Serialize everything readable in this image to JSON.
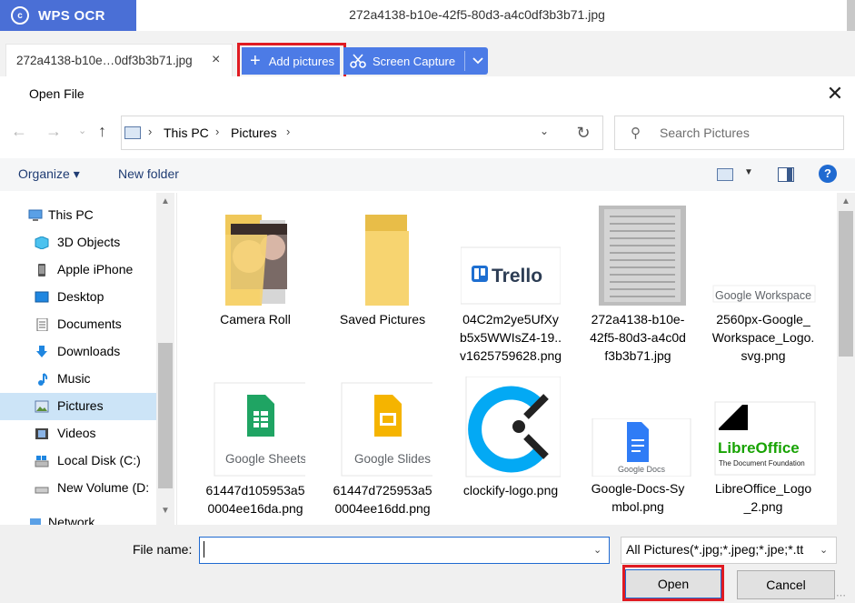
{
  "app": {
    "brand": "WPS OCR",
    "filename": "272a4138-b10e-42f5-80d3-a4c0df3b3b71.jpg",
    "tab_label": "272a4138-b10e…0df3b3b71.jpg",
    "tab_close": "×",
    "add_pictures": "Add pictures",
    "screen_capture": "Screen Capture"
  },
  "dialog": {
    "title": "Open File",
    "close": "✕",
    "address": {
      "items": [
        "This PC",
        "Pictures"
      ]
    },
    "search_placeholder": "Search Pictures",
    "toolbar": {
      "organize": "Organize ▾",
      "new_folder": "New folder"
    },
    "nav_items": [
      {
        "label": "This PC",
        "icon": "computer-icon"
      },
      {
        "label": "3D Objects",
        "icon": "cube-icon"
      },
      {
        "label": "Apple iPhone",
        "icon": "phone-icon"
      },
      {
        "label": "Desktop",
        "icon": "desktop-icon"
      },
      {
        "label": "Documents",
        "icon": "document-icon"
      },
      {
        "label": "Downloads",
        "icon": "download-icon"
      },
      {
        "label": "Music",
        "icon": "music-icon"
      },
      {
        "label": "Pictures",
        "icon": "pictures-icon"
      },
      {
        "label": "Videos",
        "icon": "video-icon"
      },
      {
        "label": "Local Disk (C:)",
        "icon": "disk-icon"
      },
      {
        "label": "New Volume (D:",
        "icon": "drive-icon"
      },
      {
        "label": "Network",
        "icon": "network-icon"
      }
    ],
    "files": [
      {
        "name": [
          "Camera Roll"
        ]
      },
      {
        "name": [
          "Saved Pictures"
        ]
      },
      {
        "name": [
          "04C2m2ye5UfXy",
          "b5x5WWIsZ4-19..",
          "v1625759628.png"
        ],
        "logo": "Trello"
      },
      {
        "name": [
          "272a4138-b10e-",
          "42f5-80d3-a4c0d",
          "f3b3b71.jpg"
        ]
      },
      {
        "name": [
          "2560px-Google_",
          "Workspace_Logo.",
          "svg.png"
        ],
        "logo": "Google Workspace"
      },
      {
        "name": [
          "61447d105953a5",
          "0004ee16da.png"
        ],
        "logo": "Google Sheets"
      },
      {
        "name": [
          "61447d725953a5",
          "0004ee16dd.png"
        ],
        "logo": "Google Slides"
      },
      {
        "name": [
          "clockify-logo.png"
        ]
      },
      {
        "name": [
          "Google-Docs-Sy",
          "mbol.png"
        ],
        "logo": "Google Docs"
      },
      {
        "name": [
          "LibreOffice_Logo",
          "_2.png"
        ],
        "logo": "LibreOffice",
        "logo_sub": "The Document Foundation"
      }
    ],
    "footer": {
      "file_name_label": "File name:",
      "file_name_value": "",
      "filter": "All Pictures(*.jpg;*.jpeg;*.jpe;*.tt",
      "open": "Open",
      "cancel": "Cancel"
    }
  },
  "colors": {
    "accent": "#4c7be6",
    "brand": "#4a6fd6",
    "highlight": "#e01b22",
    "selection": "#cce4f7"
  }
}
